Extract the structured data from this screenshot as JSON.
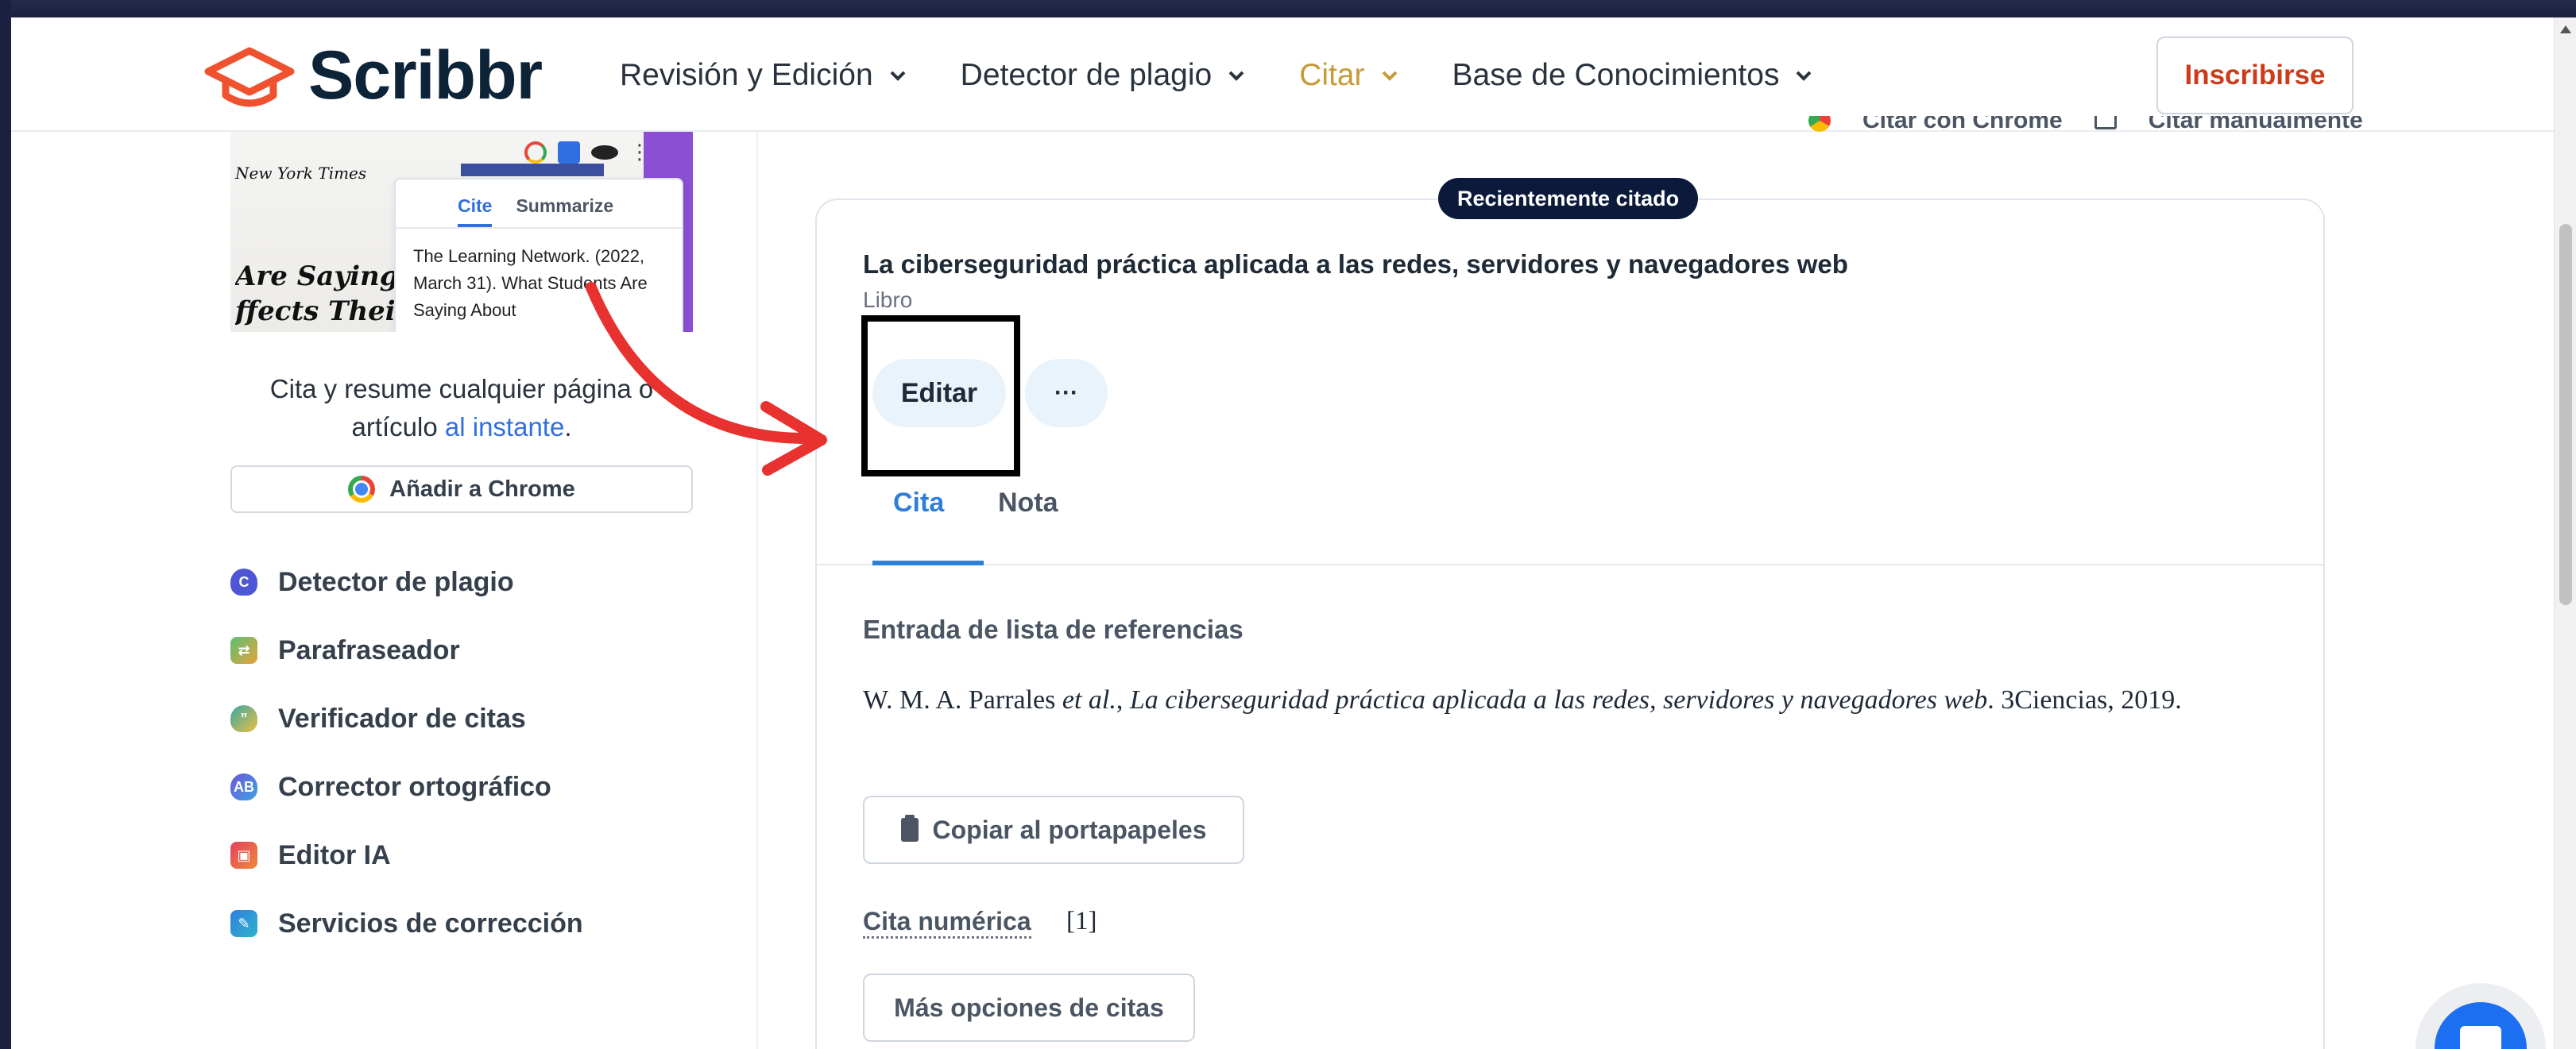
{
  "header": {
    "logo_text": "Scribbr",
    "nav": [
      {
        "label": "Revisión y Edición",
        "active": false
      },
      {
        "label": "Detector de plagio",
        "active": false
      },
      {
        "label": "Citar",
        "active": true
      },
      {
        "label": "Base de Conocimientos",
        "active": false
      }
    ],
    "signup_label": "Inscribirse"
  },
  "sidebar": {
    "promo": {
      "nyt": "New York Times",
      "headline": "Are Saying Al\nffects Their Bo",
      "tab_cite": "Cite",
      "tab_summarize": "Summarize",
      "card_text": "The Learning Network. (2022, March 31). What Students Are Saying About"
    },
    "caption_pre": "Cita y resume cualquier página o artículo ",
    "caption_link": "al instante",
    "caption_post": ".",
    "chrome_button": "Añadir a Chrome",
    "tools": [
      {
        "label": "Detector de plagio",
        "icon": "plagiarism-checker-icon"
      },
      {
        "label": "Parafraseador",
        "icon": "paraphraser-icon"
      },
      {
        "label": "Verificador de citas",
        "icon": "citation-checker-icon"
      },
      {
        "label": "Corrector ortográfico",
        "icon": "spell-checker-icon"
      },
      {
        "label": "Editor IA",
        "icon": "ai-editor-icon"
      },
      {
        "label": "Servicios de corrección",
        "icon": "proofreading-icon"
      }
    ]
  },
  "main": {
    "top_links": [
      "Citar con Chrome",
      "Citar manualmente"
    ],
    "recent_badge": "Recientemente citado",
    "citation_title": "La ciberseguridad práctica aplicada a las redes, servidores y navegadores web",
    "citation_type": "Libro",
    "edit_label": "Editar",
    "more_label": "···",
    "tabs": [
      "Cita",
      "Nota"
    ],
    "ref_heading": "Entrada de lista de referencias",
    "ref_authors": "W. M. A. Parrales ",
    "ref_etal": "et al.",
    "ref_sep": ", ",
    "ref_title": "La ciberseguridad práctica aplicada a las redes, servidores y navegadores web",
    "ref_rest": ". 3Ciencias, 2019.",
    "copy_label": "Copiar al portapapeles",
    "numeric_label": "Cita numérica",
    "numeric_value": "[1]",
    "more_options_label": "Más opciones de citas"
  },
  "colors": {
    "brand_orange": "#f0512f",
    "brand_navy": "#0d2338",
    "active_nav": "#c79a3a",
    "link_blue": "#2f7fd6",
    "annotation_arrow": "#e8322f"
  }
}
